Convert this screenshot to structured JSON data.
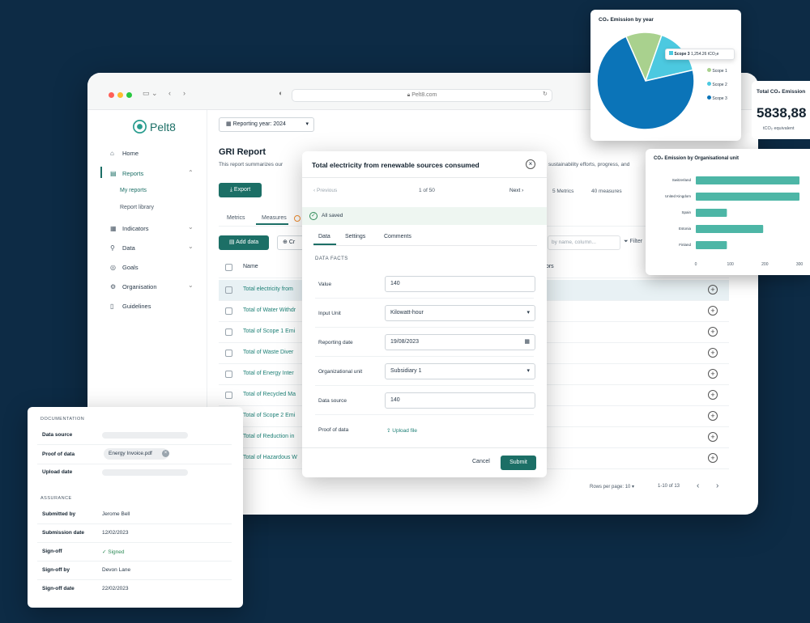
{
  "browser": {
    "url": "Pelt8.com"
  },
  "app": {
    "name": "Pelt8"
  },
  "sidebar": {
    "items": [
      {
        "label": "Home",
        "icon": "home-icon"
      },
      {
        "label": "Reports",
        "icon": "reports-icon",
        "active": true
      },
      {
        "label": "Indicators",
        "icon": "indicators-icon"
      },
      {
        "label": "Data",
        "icon": "data-icon"
      },
      {
        "label": "Goals",
        "icon": "goals-icon"
      },
      {
        "label": "Organisation",
        "icon": "organisation-icon"
      },
      {
        "label": "Guidelines",
        "icon": "guidelines-icon"
      }
    ],
    "sub_items": [
      "My reports",
      "Report library"
    ]
  },
  "main": {
    "reporting_year": "Reporting year: 2024",
    "title": "GRI Report",
    "description": "This report summarizes our",
    "description_tail": "sustainability efforts, progress, and",
    "export_label": "Export",
    "tabs": [
      "Metrics",
      "Measures"
    ],
    "add_data_label": "Add data",
    "create_label": "Cr",
    "metrics_count": "5 Metrics",
    "measures_count": "40 measures",
    "search_placeholder": "by name, column...",
    "filter_label": "Filter",
    "table_header_name": "Name",
    "table_header_actions": "tors",
    "rows": [
      "Total electricity from",
      "Total of Water Withdr",
      "Total of Scope 1 Emi",
      "Total of Waste Diver",
      "Total of Energy Inter",
      "Total of Recycled Ma",
      "Total of Scope 2 Emi",
      "Total of Reduction in",
      "Total of Hazardous W"
    ],
    "rows_per_page": "Rows per page: 10",
    "pagination": "1-10 of 13"
  },
  "modal": {
    "title": "Total electricity from renewable sources consumed",
    "previous": "Previous",
    "counter": "1 of 50",
    "next": "Next",
    "saved": "All saved",
    "tabs": [
      "Data",
      "Settings",
      "Comments"
    ],
    "section": "DATA FACTS",
    "fields": [
      {
        "label": "Value",
        "value": "140"
      },
      {
        "label": "Input Unit",
        "value": "Kilowatt-hour"
      },
      {
        "label": "Reporting date",
        "value": "19/08/2023"
      },
      {
        "label": "Organizational unit",
        "value": "Subsidiary 1"
      },
      {
        "label": "Data source",
        "value": "140"
      }
    ],
    "proof_label": "Proof of data",
    "upload_label": "Upload file",
    "cancel": "Cancel",
    "submit": "Submit"
  },
  "documentation": {
    "section_doc": "DOCUMENTATION",
    "data_source": "Data source",
    "proof_of_data": "Proof of data",
    "proof_file": "Energy Invoice.pdf",
    "upload_date": "Upload date",
    "section_assurance": "ASSURANCE",
    "rows": [
      {
        "label": "Submitted by",
        "value": "Jerome Bell"
      },
      {
        "label": "Submission date",
        "value": "12/02/2023"
      },
      {
        "label": "Sign-off",
        "value": "Signed"
      },
      {
        "label": "Sign-off by",
        "value": "Devon Lane"
      },
      {
        "label": "Sign-off date",
        "value": "22/02/2023"
      }
    ]
  },
  "pie_card": {
    "title": "CO₂ Emission by year",
    "tooltip_label": "Scope 3",
    "tooltip_value": "1,254.26 tCO₂e",
    "legend": [
      {
        "label": "Scope 1",
        "color": "#a9d18e"
      },
      {
        "label": "Scope 2",
        "color": "#4cc9e0"
      },
      {
        "label": "Scope 3",
        "color": "#0b74b8"
      }
    ]
  },
  "totals_card": {
    "title": "Total CO₂ Emission",
    "value": "5838,88",
    "unit": "tCO₂ equivalent"
  },
  "chart_data": {
    "type": "pie",
    "title": "CO₂ Emission by year",
    "categories": [
      "Scope 1",
      "Scope 2",
      "Scope 3"
    ],
    "values": [
      12,
      16,
      72
    ],
    "colors": [
      "#a9d18e",
      "#4cc9e0",
      "#0b74b8"
    ]
  },
  "bar_chart": {
    "type": "bar",
    "title": "CO₂ Emission by Organisational unit",
    "categories": [
      "Switzerland",
      "United Kingdom",
      "Spain",
      "Estonia",
      "Finland"
    ],
    "values": [
      300,
      300,
      90,
      195,
      90
    ],
    "xticks": [
      "0",
      "100",
      "200",
      "300"
    ],
    "xlim": [
      0,
      300
    ],
    "color": "#4db6a6"
  },
  "colors": {
    "primary": "#1c6f66",
    "background": "#0d2b45",
    "link": "#1c7f75"
  }
}
